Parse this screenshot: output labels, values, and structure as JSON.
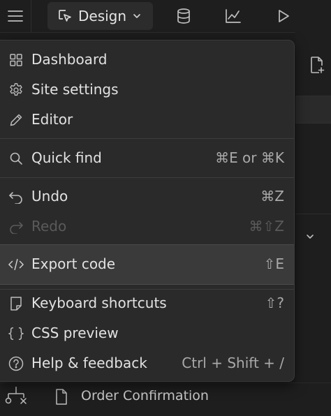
{
  "toolbar": {
    "mode_label": "Design"
  },
  "menu": {
    "items": [
      {
        "label": "Dashboard",
        "shortcut": "",
        "icon": "grid-icon"
      },
      {
        "label": "Site settings",
        "shortcut": "",
        "icon": "gear-icon"
      },
      {
        "label": "Editor",
        "shortcut": "",
        "icon": "pencil-icon"
      },
      {
        "label": "Quick find",
        "shortcut": "⌘E or ⌘K",
        "icon": "search-icon"
      },
      {
        "label": "Undo",
        "shortcut": "⌘Z",
        "icon": "undo-icon"
      },
      {
        "label": "Redo",
        "shortcut": "⌘⇧Z",
        "icon": "redo-icon",
        "disabled": true
      },
      {
        "label": "Export code",
        "shortcut": "⇧E",
        "icon": "code-icon",
        "highlighted": true
      },
      {
        "label": "Keyboard shortcuts",
        "shortcut": "⇧?",
        "icon": "keyboard-icon"
      },
      {
        "label": "CSS preview",
        "shortcut": "",
        "icon": "braces-icon"
      },
      {
        "label": "Help & feedback",
        "shortcut": "Ctrl + Shift + /",
        "icon": "help-icon"
      }
    ]
  },
  "pages": {
    "bottom_item": "Order Confirmation"
  }
}
